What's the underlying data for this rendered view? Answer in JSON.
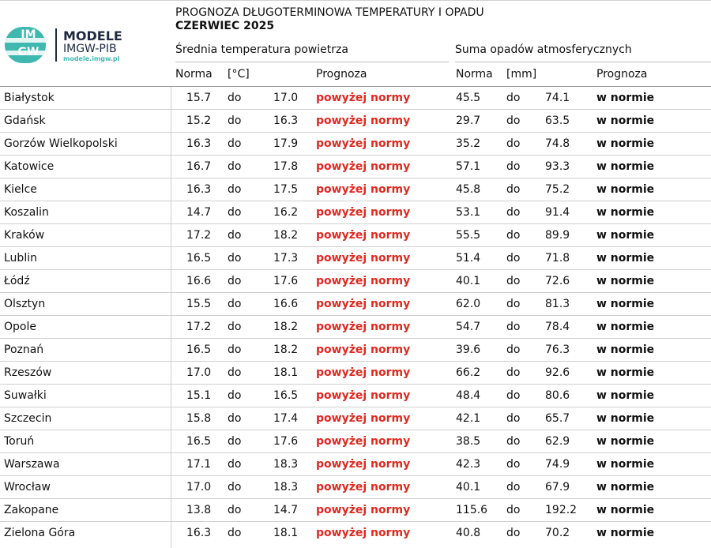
{
  "logo": {
    "mark_top": "IM",
    "mark_bottom": "GW",
    "brand_line1": "MODELE",
    "brand_line2": "IMGW-PIB",
    "brand_url": "modele.imgw.pl",
    "colors": {
      "teal": "#3fb8b0",
      "navy": "#1e2a40"
    }
  },
  "title": {
    "line1": "PROGNOZA DŁUGOTERMINOWA TEMPERATURY I OPADU",
    "line2": "CZERWIEC 2025"
  },
  "sections": {
    "temperature": "Średnia temperatura powietrza",
    "precipitation": "Suma opadów atmosferycznych"
  },
  "columns": {
    "norma": "Norma",
    "temp_unit": "[°C]",
    "forecast": "Prognoza",
    "rain_unit": "[mm]"
  },
  "colors": {
    "above_normal": "#e0281e",
    "text": "#111111"
  },
  "rows": [
    {
      "city": "Białystok",
      "t_min": "15.7",
      "t_sep": "do",
      "t_max": "17.0",
      "t_fc": "powyżej normy",
      "r_min": "45.5",
      "r_sep": "do",
      "r_max": "74.1",
      "r_fc": "w normie"
    },
    {
      "city": "Gdańsk",
      "t_min": "15.2",
      "t_sep": "do",
      "t_max": "16.3",
      "t_fc": "powyżej normy",
      "r_min": "29.7",
      "r_sep": "do",
      "r_max": "63.5",
      "r_fc": "w normie"
    },
    {
      "city": "Gorzów Wielkopolski",
      "t_min": "16.3",
      "t_sep": "do",
      "t_max": "17.9",
      "t_fc": "powyżej normy",
      "r_min": "35.2",
      "r_sep": "do",
      "r_max": "74.8",
      "r_fc": "w normie"
    },
    {
      "city": "Katowice",
      "t_min": "16.7",
      "t_sep": "do",
      "t_max": "17.8",
      "t_fc": "powyżej normy",
      "r_min": "57.1",
      "r_sep": "do",
      "r_max": "93.3",
      "r_fc": "w normie"
    },
    {
      "city": "Kielce",
      "t_min": "16.3",
      "t_sep": "do",
      "t_max": "17.5",
      "t_fc": "powyżej normy",
      "r_min": "45.8",
      "r_sep": "do",
      "r_max": "75.2",
      "r_fc": "w normie"
    },
    {
      "city": "Koszalin",
      "t_min": "14.7",
      "t_sep": "do",
      "t_max": "16.2",
      "t_fc": "powyżej normy",
      "r_min": "53.1",
      "r_sep": "do",
      "r_max": "91.4",
      "r_fc": "w normie"
    },
    {
      "city": "Kraków",
      "t_min": "17.2",
      "t_sep": "do",
      "t_max": "18.2",
      "t_fc": "powyżej normy",
      "r_min": "55.5",
      "r_sep": "do",
      "r_max": "89.9",
      "r_fc": "w normie"
    },
    {
      "city": "Lublin",
      "t_min": "16.5",
      "t_sep": "do",
      "t_max": "17.3",
      "t_fc": "powyżej normy",
      "r_min": "51.4",
      "r_sep": "do",
      "r_max": "71.8",
      "r_fc": "w normie"
    },
    {
      "city": "Łódź",
      "t_min": "16.6",
      "t_sep": "do",
      "t_max": "17.6",
      "t_fc": "powyżej normy",
      "r_min": "40.1",
      "r_sep": "do",
      "r_max": "72.6",
      "r_fc": "w normie"
    },
    {
      "city": "Olsztyn",
      "t_min": "15.5",
      "t_sep": "do",
      "t_max": "16.6",
      "t_fc": "powyżej normy",
      "r_min": "62.0",
      "r_sep": "do",
      "r_max": "81.3",
      "r_fc": "w normie"
    },
    {
      "city": "Opole",
      "t_min": "17.2",
      "t_sep": "do",
      "t_max": "18.2",
      "t_fc": "powyżej normy",
      "r_min": "54.7",
      "r_sep": "do",
      "r_max": "78.4",
      "r_fc": "w normie"
    },
    {
      "city": "Poznań",
      "t_min": "16.5",
      "t_sep": "do",
      "t_max": "18.2",
      "t_fc": "powyżej normy",
      "r_min": "39.6",
      "r_sep": "do",
      "r_max": "76.3",
      "r_fc": "w normie"
    },
    {
      "city": "Rzeszów",
      "t_min": "17.0",
      "t_sep": "do",
      "t_max": "18.1",
      "t_fc": "powyżej normy",
      "r_min": "66.2",
      "r_sep": "do",
      "r_max": "92.6",
      "r_fc": "w normie"
    },
    {
      "city": "Suwałki",
      "t_min": "15.1",
      "t_sep": "do",
      "t_max": "16.5",
      "t_fc": "powyżej normy",
      "r_min": "48.4",
      "r_sep": "do",
      "r_max": "80.6",
      "r_fc": "w normie"
    },
    {
      "city": "Szczecin",
      "t_min": "15.8",
      "t_sep": "do",
      "t_max": "17.4",
      "t_fc": "powyżej normy",
      "r_min": "42.1",
      "r_sep": "do",
      "r_max": "65.7",
      "r_fc": "w normie"
    },
    {
      "city": "Toruń",
      "t_min": "16.5",
      "t_sep": "do",
      "t_max": "17.6",
      "t_fc": "powyżej normy",
      "r_min": "38.5",
      "r_sep": "do",
      "r_max": "62.9",
      "r_fc": "w normie"
    },
    {
      "city": "Warszawa",
      "t_min": "17.1",
      "t_sep": "do",
      "t_max": "18.3",
      "t_fc": "powyżej normy",
      "r_min": "42.3",
      "r_sep": "do",
      "r_max": "74.9",
      "r_fc": "w normie"
    },
    {
      "city": "Wrocław",
      "t_min": "17.0",
      "t_sep": "do",
      "t_max": "18.3",
      "t_fc": "powyżej normy",
      "r_min": "40.1",
      "r_sep": "do",
      "r_max": "67.9",
      "r_fc": "w normie"
    },
    {
      "city": "Zakopane",
      "t_min": "13.8",
      "t_sep": "do",
      "t_max": "14.7",
      "t_fc": "powyżej normy",
      "r_min": "115.6",
      "r_sep": "do",
      "r_max": "192.2",
      "r_fc": "w normie"
    },
    {
      "city": "Zielona Góra",
      "t_min": "16.3",
      "t_sep": "do",
      "t_max": "18.1",
      "t_fc": "powyżej normy",
      "r_min": "40.8",
      "r_sep": "do",
      "r_max": "70.2",
      "r_fc": "w normie"
    }
  ]
}
